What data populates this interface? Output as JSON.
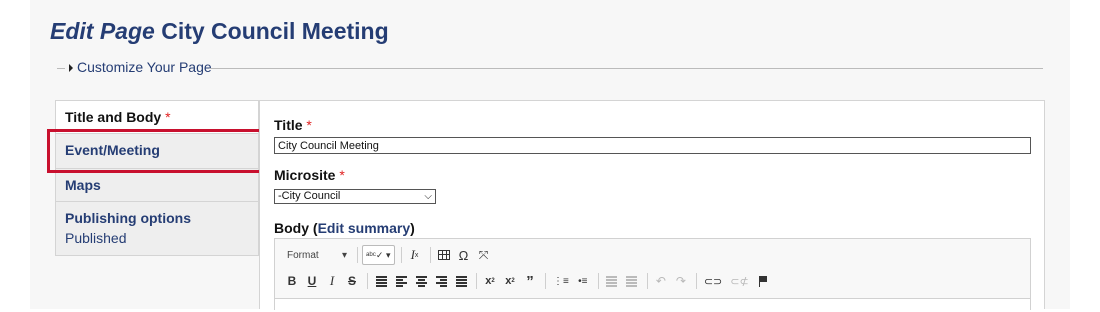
{
  "header": {
    "title_prefix": "Edit Page",
    "title_name": "City Council Meeting"
  },
  "customize": {
    "legend": "Customize Your Page"
  },
  "vtabs": {
    "items": [
      {
        "label": "Title and Body",
        "required": "*"
      },
      {
        "label": "Event/Meeting"
      },
      {
        "label": "Maps"
      },
      {
        "label": "Publishing options",
        "sub": "Published"
      }
    ]
  },
  "form": {
    "title_label": "Title",
    "title_value": "City Council Meeting",
    "required_mark": "*",
    "microsite_label": "Microsite",
    "microsite_value": "-City Council",
    "body_label": "Body",
    "edit_summary_link": "Edit summary"
  },
  "editor": {
    "format_label": "Format",
    "tools_row1": [
      "spellcheck-icon",
      "remove-format-icon",
      "table-icon",
      "special-char-icon",
      "maximize-icon"
    ],
    "tools_row2": [
      "bold-icon",
      "underline-icon",
      "italic-icon",
      "strike-icon",
      "justify-icon",
      "align-left-icon",
      "align-center-icon",
      "align-right-icon",
      "align-justify-icon",
      "subscript-icon",
      "superscript-icon",
      "blockquote-icon",
      "numbered-list-icon",
      "bullet-list-icon",
      "outdent-icon",
      "indent-icon",
      "undo-icon",
      "redo-icon",
      "link-icon",
      "unlink-icon",
      "anchor-flag-icon"
    ]
  },
  "colors": {
    "accent": "#253d74",
    "highlight": "#c8102e",
    "required": "#e02020"
  }
}
